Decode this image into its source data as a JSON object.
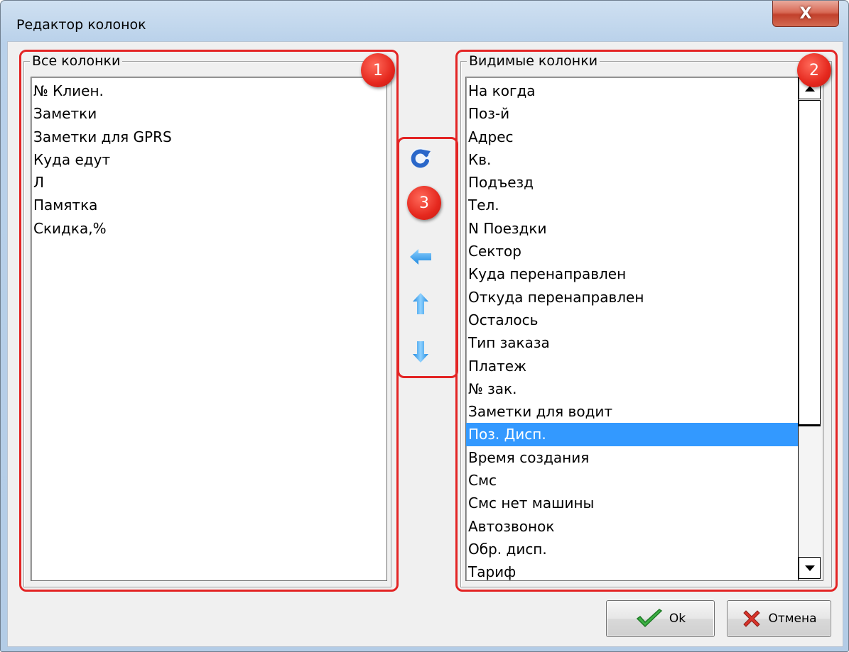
{
  "window": {
    "title": "Редактор колонок",
    "close_glyph": "X"
  },
  "all_columns": {
    "label": "Все колонки",
    "items": [
      "№ Клиен.",
      "Заметки",
      "Заметки для GPRS",
      "Куда едут",
      "Л",
      "Памятка",
      "Скидка,%"
    ]
  },
  "visible_columns": {
    "label": "Видимые колонки",
    "selected": "Поз. Дисп.",
    "items": [
      "На когда",
      "Поз-й",
      "Адрес",
      "Кв.",
      "Подъезд",
      "Тел.",
      "N Поездки",
      "Сектор",
      "Куда перенаправлен",
      "Откуда перенаправлен",
      "Осталось",
      "Тип заказа",
      "Платеж",
      "№ зак.",
      "Заметки для водит",
      "Поз. Дисп.",
      "Время создания",
      "Смс",
      "Смс нет машины",
      "Автозвонок",
      "Обр. дисп.",
      "Тариф"
    ]
  },
  "toolbar": {
    "icons": [
      "refresh-icon",
      "arrow-left-icon",
      "arrow-up-icon",
      "arrow-down-icon"
    ]
  },
  "annotations": {
    "badge1": "1",
    "badge2": "2",
    "badge3": "3",
    "color": "#e32424"
  },
  "buttons": {
    "ok_label": "Ok",
    "cancel_label": "Отмена"
  },
  "colors": {
    "selection": "#3399ff",
    "arrow": "#1e90e8",
    "ok_check": "#3cb043",
    "cancel_x": "#d9342b"
  }
}
